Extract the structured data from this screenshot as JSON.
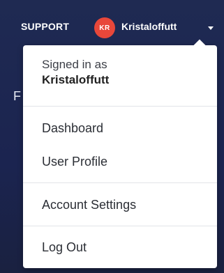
{
  "header": {
    "support_label": "SUPPORT",
    "avatar_initials": "KR",
    "avatar_color": "#e8473a",
    "username": "Kristaloffutt",
    "background_color": "#1f2a52"
  },
  "menu": {
    "signed_in_label": "Signed in as",
    "signed_in_user": "Kristaloffutt",
    "items": [
      {
        "label": "Dashboard"
      },
      {
        "label": "User Profile"
      },
      {
        "label": "Account Settings"
      },
      {
        "label": "Log Out"
      }
    ]
  },
  "background_partial_text": "F"
}
